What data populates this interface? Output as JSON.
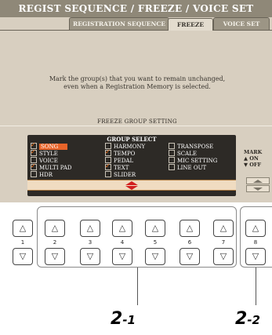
{
  "screen": {
    "title": "REGIST SEQUENCE / FREEZE / VOICE SET",
    "tabs": [
      {
        "label": "REGISTRATION SEQUENCE"
      },
      {
        "label": "FREEZE"
      },
      {
        "label": "VOICE SET"
      }
    ],
    "message_line1": "Mark the group(s) that you want to remain unchanged,",
    "message_line2": "even when a Registration Memory is selected.",
    "freeze_label": "FREEZE GROUP SETTING",
    "group_select": {
      "title": "GROUP SELECT",
      "items": [
        {
          "label": "SONG",
          "checked": true,
          "selected": true
        },
        {
          "label": "STYLE",
          "checked": true,
          "selected": false
        },
        {
          "label": "VOICE",
          "checked": false,
          "selected": false
        },
        {
          "label": "MULTI PAD",
          "checked": true,
          "selected": false
        },
        {
          "label": "HDR",
          "checked": false,
          "selected": false
        },
        {
          "label": "HARMONY",
          "checked": false,
          "selected": false
        },
        {
          "label": "TEMPO",
          "checked": true,
          "selected": false
        },
        {
          "label": "PEDAL",
          "checked": false,
          "selected": false
        },
        {
          "label": "TEXT",
          "checked": true,
          "selected": false
        },
        {
          "label": "SLIDER",
          "checked": false,
          "selected": false
        },
        {
          "label": "TRANSPOSE",
          "checked": false,
          "selected": false
        },
        {
          "label": "SCALE",
          "checked": false,
          "selected": false
        },
        {
          "label": "MIC SETTING",
          "checked": false,
          "selected": false
        },
        {
          "label": "LINE OUT",
          "checked": false,
          "selected": false
        }
      ]
    },
    "mark": {
      "line1": "MARK",
      "line2": "▲ ON",
      "line3": "▼ OFF"
    }
  },
  "buttons": {
    "up_glyph": "△",
    "down_glyph": "▽",
    "numbers": [
      "1",
      "2",
      "3",
      "4",
      "5",
      "6",
      "7",
      "8"
    ]
  },
  "callouts": {
    "c1_big": "2",
    "c1_small": "-1",
    "c2_big": "2",
    "c2_small": "-2"
  }
}
